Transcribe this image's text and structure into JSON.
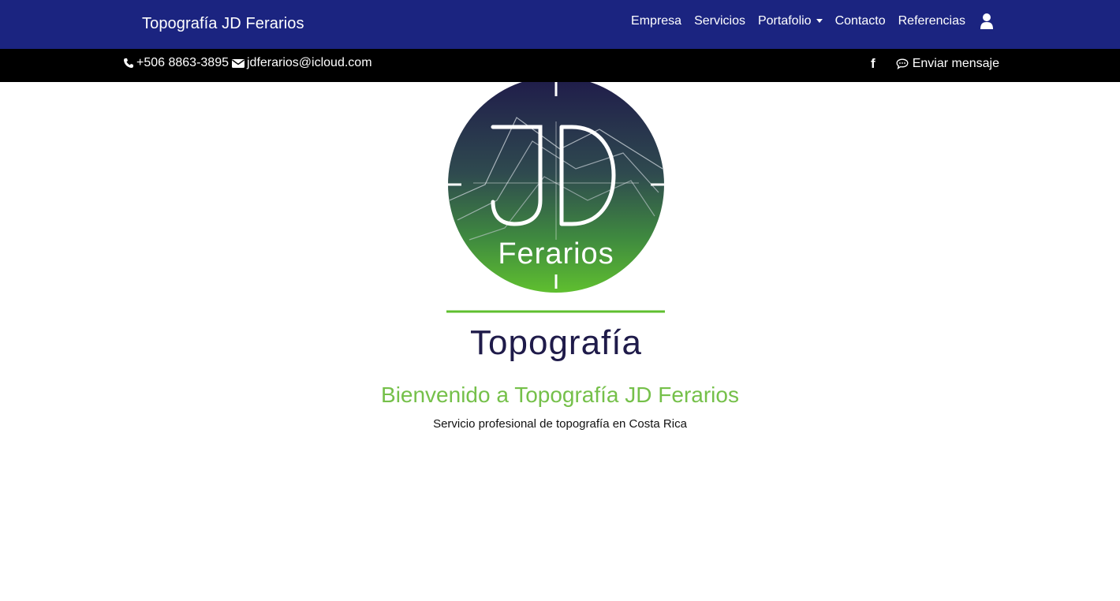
{
  "colors": {
    "navbar_bg": "#1b2480",
    "topbar_bg": "#000000",
    "accent_green": "#75c04a",
    "logo_navy": "#1f1b4a"
  },
  "navbar": {
    "brand": "Topografía JD Ferarios",
    "links": {
      "empresa": "Empresa",
      "servicios": "Servicios",
      "portafolio": "Portafolio",
      "contacto": "Contacto",
      "referencias": "Referencias"
    },
    "user_icon": "user-icon"
  },
  "topbar": {
    "phone_icon": "phone-icon",
    "phone": "+506 8863-3895",
    "email_icon": "envelope-icon",
    "email": "jdferarios@icloud.com",
    "facebook_icon": "facebook-icon",
    "message_icon": "speech-bubble-icon",
    "message_label": "Enviar mensaje"
  },
  "logo": {
    "initials": "JD",
    "name": "Ferarios",
    "subtitle": "Topografía"
  },
  "hero": {
    "title": "Bienvenido a Topografía JD Ferarios",
    "subtitle": "Servicio profesional de topografía en Costa Rica"
  }
}
